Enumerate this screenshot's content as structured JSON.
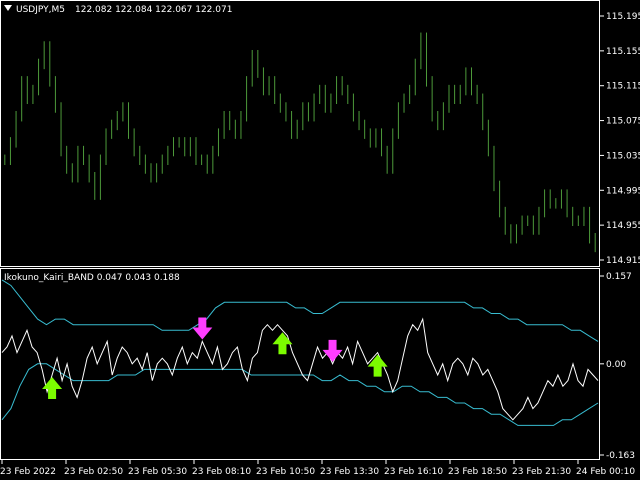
{
  "colors": {
    "background": "#000000",
    "foreground": "#ffffff",
    "price_bars": "#4d9a3a",
    "band": "#38bcd0",
    "kairi_line": "#ffffff",
    "buy_arrow": "#7cfc00",
    "sell_arrow": "#ff3dff"
  },
  "icons": {
    "collapse": "triangle-down-icon",
    "buy_signal": "arrow-up-icon",
    "sell_signal": "arrow-down-icon"
  },
  "main_chart": {
    "symbol_timeframe": "USDJPY,M5",
    "ohlc": "122.082 122.084 122.067 122.071"
  },
  "indicator": {
    "header": "Ikokuno_Kairi_BAND 0.047 0.043 0.188"
  },
  "chart_data": [
    {
      "type": "bar",
      "title": "USDJPY,M5",
      "ylim": [
        114.915,
        115.195
      ],
      "ytick_labels": [
        "115.195",
        "115.155",
        "115.115",
        "115.075",
        "115.035",
        "114.995",
        "114.955",
        "114.915"
      ],
      "series": [
        {
          "values": [
            115.03,
            115.05,
            115.08,
            115.12,
            115.1,
            115.11,
            115.14,
            115.16,
            115.12,
            115.09,
            115.04,
            115.02,
            115.01,
            115.04,
            115.03,
            115.01,
            114.99,
            115.03,
            115.06,
            115.07,
            115.08,
            115.09,
            115.06,
            115.04,
            115.03,
            115.02,
            115.01,
            115.02,
            115.03,
            115.04,
            115.05,
            115.05,
            115.04,
            115.05,
            115.03,
            115.03,
            115.02,
            115.04,
            115.06,
            115.08,
            115.07,
            115.06,
            115.08,
            115.12,
            115.15,
            115.13,
            115.11,
            115.12,
            115.1,
            115.09,
            115.08,
            115.06,
            115.07,
            115.09,
            115.08,
            115.1,
            115.11,
            115.09,
            115.1,
            115.12,
            115.11,
            115.1,
            115.08,
            115.07,
            115.06,
            115.05,
            115.06,
            115.04,
            115.02,
            115.06,
            115.09,
            115.1,
            115.11,
            115.14,
            115.17,
            115.12,
            115.08,
            115.07,
            115.09,
            115.11,
            115.1,
            115.11,
            115.13,
            115.11,
            115.1,
            115.07,
            115.04,
            115.0,
            114.97,
            114.95,
            114.94,
            114.95,
            114.96,
            114.96,
            114.95,
            114.97,
            114.99,
            114.98,
            114.98,
            114.99,
            114.97,
            114.96,
            114.96,
            114.97,
            114.94,
            114.93
          ]
        }
      ]
    },
    {
      "type": "line",
      "title": "Ikokuno_Kairi_BAND",
      "ylim": [
        -0.163,
        0.157
      ],
      "ytick_labels": [
        "0.157",
        "0.00",
        "-0.163"
      ],
      "x_tick_labels": [
        "23 Feb 2022",
        "23 Feb 02:50",
        "23 Feb 05:30",
        "23 Feb 08:10",
        "23 Feb 10:50",
        "23 Feb 13:30",
        "23 Feb 16:10",
        "23 Feb 18:50",
        "23 Feb 21:30",
        "24 Feb 00:10"
      ],
      "series": [
        {
          "name": "Ikokuno_Kairi_BAND",
          "values": [
            0.02,
            0.03,
            0.05,
            0.02,
            0.04,
            0.06,
            0.03,
            0.02,
            -0.01,
            -0.05,
            -0.02,
            0.01,
            -0.03,
            0.0,
            -0.04,
            -0.06,
            -0.03,
            0.01,
            0.03,
            0.0,
            0.02,
            0.04,
            -0.02,
            0.01,
            0.03,
            0.02,
            0.0,
            0.01,
            -0.01,
            0.02,
            -0.03,
            0.0,
            0.01,
            0.0,
            -0.02,
            0.01,
            0.03,
            0.0,
            0.02,
            0.01,
            0.04,
            0.02,
            0.0,
            0.03,
            -0.01,
            0.0,
            0.02,
            0.03,
            -0.01,
            -0.03,
            0.01,
            0.02,
            0.06,
            0.07,
            0.06,
            0.07,
            0.06,
            0.05,
            0.02,
            0.0,
            -0.02,
            -0.03,
            0.0,
            0.03,
            0.01,
            0.02,
            0.0,
            0.02,
            0.01,
            0.03,
            0.0,
            0.04,
            0.02,
            0.0,
            0.01,
            0.02,
            0.0,
            -0.02,
            -0.05,
            -0.03,
            0.01,
            0.05,
            0.07,
            0.06,
            0.08,
            0.02,
            0.0,
            -0.02,
            0.0,
            -0.03,
            0.0,
            0.01,
            0.0,
            -0.02,
            0.01,
            0.0,
            -0.02,
            -0.01,
            -0.03,
            -0.05,
            -0.08,
            -0.09,
            -0.1,
            -0.09,
            -0.08,
            -0.06,
            -0.08,
            -0.07,
            -0.05,
            -0.03,
            -0.04,
            -0.02,
            -0.04,
            -0.03,
            0.0,
            -0.03,
            -0.04,
            -0.01,
            -0.02,
            -0.03
          ]
        },
        {
          "name": "upper",
          "values": [
            0.15,
            0.14,
            0.12,
            0.1,
            0.08,
            0.07,
            0.08,
            0.08,
            0.07,
            0.07,
            0.07,
            0.07,
            0.07,
            0.07,
            0.07,
            0.07,
            0.07,
            0.07,
            0.06,
            0.06,
            0.06,
            0.06,
            0.07,
            0.08,
            0.1,
            0.11,
            0.11,
            0.11,
            0.11,
            0.11,
            0.11,
            0.11,
            0.11,
            0.1,
            0.1,
            0.09,
            0.09,
            0.1,
            0.11,
            0.11,
            0.11,
            0.11,
            0.11,
            0.11,
            0.11,
            0.11,
            0.11,
            0.11,
            0.11,
            0.11,
            0.11,
            0.11,
            0.11,
            0.1,
            0.1,
            0.09,
            0.09,
            0.08,
            0.08,
            0.07,
            0.07,
            0.07,
            0.07,
            0.07,
            0.06,
            0.06,
            0.05,
            0.04
          ]
        },
        {
          "name": "lower",
          "values": [
            -0.1,
            -0.08,
            -0.04,
            -0.01,
            0.0,
            0.0,
            -0.01,
            -0.02,
            -0.03,
            -0.03,
            -0.03,
            -0.03,
            -0.03,
            -0.02,
            -0.02,
            -0.02,
            -0.01,
            -0.01,
            -0.01,
            -0.01,
            -0.01,
            -0.01,
            -0.01,
            -0.01,
            -0.01,
            -0.01,
            -0.01,
            -0.01,
            -0.02,
            -0.02,
            -0.02,
            -0.02,
            -0.02,
            -0.02,
            -0.02,
            -0.02,
            -0.03,
            -0.03,
            -0.02,
            -0.03,
            -0.03,
            -0.04,
            -0.04,
            -0.05,
            -0.05,
            -0.04,
            -0.04,
            -0.05,
            -0.05,
            -0.06,
            -0.06,
            -0.07,
            -0.07,
            -0.08,
            -0.08,
            -0.09,
            -0.09,
            -0.1,
            -0.11,
            -0.11,
            -0.11,
            -0.11,
            -0.11,
            -0.1,
            -0.1,
            -0.09,
            -0.08,
            -0.07
          ]
        }
      ],
      "signals": [
        {
          "kind": "buy",
          "series_index": 10
        },
        {
          "kind": "sell",
          "series_index": 40
        },
        {
          "kind": "buy",
          "series_index": 56
        },
        {
          "kind": "sell",
          "series_index": 66
        },
        {
          "kind": "buy",
          "series_index": 75
        }
      ]
    }
  ]
}
